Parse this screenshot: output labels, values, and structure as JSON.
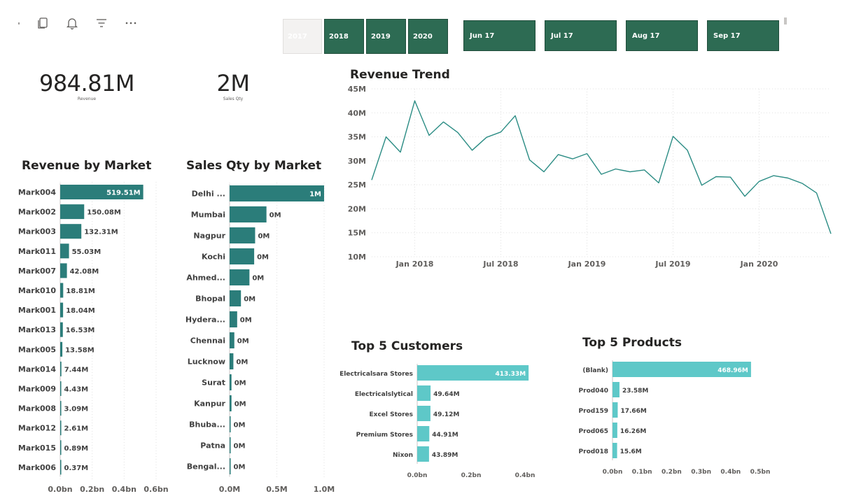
{
  "toolbar": {
    "icons": [
      "tick-mark-icon",
      "copy-icon",
      "bell-icon",
      "filter-icon",
      "more-options-icon"
    ]
  },
  "year_slicer": {
    "items": [
      {
        "label": "2017",
        "selected": false
      },
      {
        "label": "2018",
        "selected": true
      },
      {
        "label": "2019",
        "selected": true
      },
      {
        "label": "2020",
        "selected": true
      }
    ]
  },
  "month_slicer": {
    "items": [
      "Jun 17",
      "Jul 17",
      "Aug 17",
      "Sep 17"
    ]
  },
  "kpis": {
    "revenue": {
      "value": "984.81M",
      "label": "Revenue"
    },
    "sales_qty": {
      "value": "2M",
      "label": "Sales Qty"
    }
  },
  "colors": {
    "market_bar": "#2b7d7a",
    "top5_bar": "#5ec8c8",
    "trend_line": "#2b8c84",
    "slicer_selected": "#2d6b53"
  },
  "chart_data": [
    {
      "id": "revenue_by_market",
      "type": "bar",
      "orientation": "horizontal",
      "title": "Revenue by Market",
      "categories": [
        "Mark004",
        "Mark002",
        "Mark003",
        "Mark011",
        "Mark007",
        "Mark010",
        "Mark001",
        "Mark013",
        "Mark005",
        "Mark014",
        "Mark009",
        "Mark008",
        "Mark012",
        "Mark015",
        "Mark006"
      ],
      "values": [
        519.51,
        150.08,
        132.31,
        55.03,
        42.08,
        18.81,
        18.04,
        16.53,
        13.58,
        7.44,
        4.43,
        3.09,
        2.61,
        0.89,
        0.37
      ],
      "labels": [
        "519.51M",
        "150.08M",
        "132.31M",
        "55.03M",
        "42.08M",
        "18.81M",
        "18.04M",
        "16.53M",
        "13.58M",
        "7.44M",
        "4.43M",
        "3.09M",
        "2.61M",
        "0.89M",
        "0.37M"
      ],
      "units": "M",
      "xlim": [
        0,
        600
      ],
      "xticks": [
        0,
        200,
        400,
        600
      ],
      "xtick_labels": [
        "0.0bn",
        "0.2bn",
        "0.4bn",
        "0.6bn"
      ],
      "grid": true
    },
    {
      "id": "sales_qty_by_market",
      "type": "bar",
      "orientation": "horizontal",
      "title": "Sales Qty by Market",
      "categories": [
        "Delhi ...",
        "Mumbai",
        "Nagpur",
        "Kochi",
        "Ahmed...",
        "Bhopal",
        "Hydera...",
        "Chennai",
        "Lucknow",
        "Surat",
        "Kanpur",
        "Bhuba...",
        "Patna",
        "Bengal..."
      ],
      "values": [
        1.0,
        0.39,
        0.27,
        0.26,
        0.21,
        0.12,
        0.08,
        0.05,
        0.04,
        0.02,
        0.02,
        0.01,
        0.003,
        0.002
      ],
      "labels": [
        "1M",
        "0M",
        "0M",
        "0M",
        "0M",
        "0M",
        "0M",
        "0M",
        "0M",
        "0M",
        "0M",
        "0M",
        "0M",
        "0M"
      ],
      "units": "M",
      "xlim": [
        0,
        1.0
      ],
      "xticks": [
        0,
        0.5,
        1.0
      ],
      "xtick_labels": [
        "0.0M",
        "0.5M",
        "1.0M"
      ],
      "grid": true
    },
    {
      "id": "revenue_trend",
      "type": "line",
      "title": "Revenue Trend",
      "x": [
        "2017-10",
        "2017-11",
        "2017-12",
        "2018-01",
        "2018-02",
        "2018-03",
        "2018-04",
        "2018-05",
        "2018-06",
        "2018-07",
        "2018-08",
        "2018-09",
        "2018-10",
        "2018-11",
        "2018-12",
        "2019-01",
        "2019-02",
        "2019-03",
        "2019-04",
        "2019-05",
        "2019-06",
        "2019-07",
        "2019-08",
        "2019-09",
        "2019-10",
        "2019-11",
        "2019-12",
        "2020-01",
        "2020-02",
        "2020-03",
        "2020-04",
        "2020-05",
        "2020-06"
      ],
      "values": [
        26.0,
        35.0,
        31.8,
        42.5,
        35.3,
        38.1,
        35.9,
        32.2,
        34.9,
        36.0,
        39.4,
        30.2,
        27.7,
        31.3,
        30.4,
        31.5,
        27.2,
        28.3,
        27.7,
        28.1,
        25.4,
        35.1,
        32.2,
        24.9,
        26.7,
        26.6,
        22.6,
        25.7,
        26.9,
        26.4,
        25.3,
        23.3,
        14.8
      ],
      "units": "M",
      "ylim": [
        10,
        45
      ],
      "yticks": [
        10,
        15,
        20,
        25,
        30,
        35,
        40,
        45
      ],
      "ytick_labels": [
        "10M",
        "15M",
        "20M",
        "25M",
        "30M",
        "35M",
        "40M",
        "45M"
      ],
      "xtick_labels": [
        {
          "label": "Jan 2018",
          "at": "2018-01"
        },
        {
          "label": "Jul 2018",
          "at": "2018-07"
        },
        {
          "label": "Jan 2019",
          "at": "2019-01"
        },
        {
          "label": "Jul 2019",
          "at": "2019-07"
        },
        {
          "label": "Jan 2020",
          "at": "2020-01"
        }
      ],
      "grid": true
    },
    {
      "id": "top5_customers",
      "type": "bar",
      "orientation": "horizontal",
      "title": "Top 5 Customers",
      "categories": [
        "Electricalsara Stores",
        "Electricalslytical",
        "Excel Stores",
        "Premium Stores",
        "Nixon"
      ],
      "values": [
        413.33,
        49.64,
        49.12,
        44.91,
        43.89
      ],
      "labels": [
        "413.33M",
        "49.64M",
        "49.12M",
        "44.91M",
        "43.89M"
      ],
      "units": "M",
      "xlim": [
        0,
        400
      ],
      "xticks": [
        0,
        200,
        400
      ],
      "xtick_labels": [
        "0.0bn",
        "0.2bn",
        "0.4bn"
      ],
      "grid": false
    },
    {
      "id": "top5_products",
      "type": "bar",
      "orientation": "horizontal",
      "title": "Top 5 Products",
      "categories": [
        "(Blank)",
        "Prod040",
        "Prod159",
        "Prod065",
        "Prod018"
      ],
      "values": [
        468.96,
        23.58,
        17.66,
        16.26,
        15.6
      ],
      "labels": [
        "468.96M",
        "23.58M",
        "17.66M",
        "16.26M",
        "15.6M"
      ],
      "units": "M",
      "xlim": [
        0,
        500
      ],
      "xticks": [
        0,
        100,
        200,
        300,
        400,
        500
      ],
      "xtick_labels": [
        "0.0bn",
        "0.1bn",
        "0.2bn",
        "0.3bn",
        "0.4bn",
        "0.5bn"
      ],
      "grid": false
    }
  ]
}
